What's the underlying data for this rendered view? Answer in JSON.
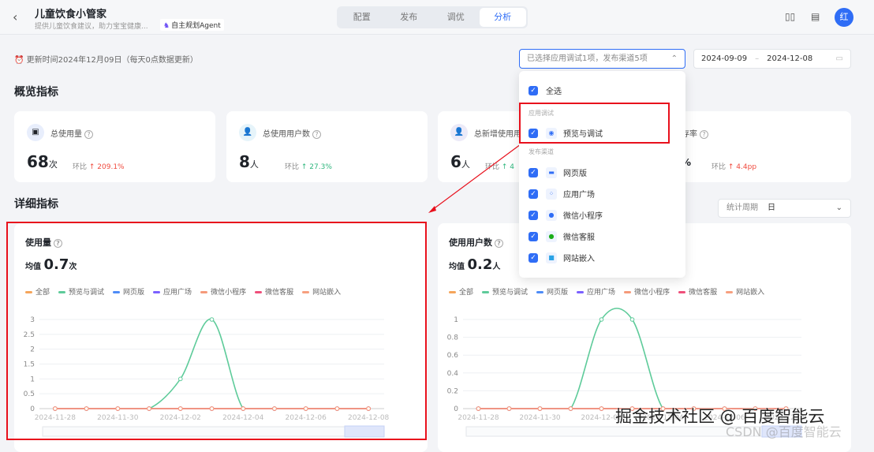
{
  "header": {
    "title": "儿童饮食小管家",
    "subtitle": "提供儿童饮食建议，助力宝宝健康...",
    "badge": "自主规划Agent",
    "avatar": "红",
    "tabs": [
      {
        "label": "配置"
      },
      {
        "label": "发布"
      },
      {
        "label": "调优"
      },
      {
        "label": "分析"
      }
    ]
  },
  "update_text": "更新时间2024年12月09日（每天0点数据更新）",
  "filter": {
    "selected_text": "已选择应用调试1项，发布渠道5项",
    "date_start": "2024-09-09",
    "date_end": "2024-12-08",
    "period_label": "统计周期",
    "period_value": "日"
  },
  "overview": {
    "title": "概览指标",
    "compare_label": "环比",
    "cards": [
      {
        "label": "总使用量",
        "value": "68",
        "unit": "次",
        "change": "↑ 209.1%"
      },
      {
        "label": "总使用用户数",
        "value": "8",
        "unit": "人",
        "change": "↑ 27.3%"
      },
      {
        "label": "总新增使用用户数",
        "value": "6",
        "unit": "人",
        "change": "↑ 4"
      },
      {
        "label": "使用用户平均日留存率",
        "value": "",
        "unit": "%",
        "change": "↑ 4.4pp"
      }
    ]
  },
  "detail": {
    "title": "详细指标"
  },
  "dropdown": {
    "select_all": "全选",
    "group1": "应用调试",
    "group2": "发布渠道",
    "items": [
      {
        "label": "预览与调试"
      },
      {
        "label": "网页版"
      },
      {
        "label": "应用广场"
      },
      {
        "label": "微信小程序"
      },
      {
        "label": "微信客服"
      },
      {
        "label": "网站嵌入"
      }
    ]
  },
  "watermark": {
    "main": "掘金技术社区 @ 百度智能云",
    "sub": "CSDN @百度智能云"
  },
  "chart_data": [
    {
      "type": "line",
      "title": "使用量",
      "avg_label": "均值",
      "avg": "0.7",
      "avg_unit": "次",
      "x": [
        "2024-11-28",
        "2024-11-29",
        "2024-11-30",
        "2024-12-01",
        "2024-12-02",
        "2024-12-03",
        "2024-12-04",
        "2024-12-05",
        "2024-12-06",
        "2024-12-07",
        "2024-12-08"
      ],
      "xticks": [
        "2024-11-28",
        "2024-11-30",
        "2024-12-02",
        "2024-12-04",
        "2024-12-06",
        "2024-12-08"
      ],
      "ylim": [
        0,
        3
      ],
      "yticks": [
        "0",
        "0.5",
        "1",
        "1.5",
        "2",
        "2.5",
        "3"
      ],
      "series": [
        {
          "name": "全部",
          "color": "#f5a55b",
          "values": [
            0,
            0,
            0,
            0,
            0,
            0,
            0,
            0,
            0,
            0,
            0
          ]
        },
        {
          "name": "预览与调试",
          "color": "#5ecb9a",
          "values": [
            0,
            0,
            0,
            0,
            1,
            3,
            0,
            0,
            0,
            0,
            0
          ]
        },
        {
          "name": "网页版",
          "color": "#4e8cf7",
          "values": [
            0,
            0,
            0,
            0,
            0,
            0,
            0,
            0,
            0,
            0,
            0
          ]
        },
        {
          "name": "应用广场",
          "color": "#7b61ff",
          "values": [
            0,
            0,
            0,
            0,
            0,
            0,
            0,
            0,
            0,
            0,
            0
          ]
        },
        {
          "name": "微信小程序",
          "color": "#f59a7a",
          "values": [
            0,
            0,
            0,
            0,
            0,
            0,
            0,
            0,
            0,
            0,
            0
          ]
        },
        {
          "name": "微信客服",
          "color": "#ef4f7a",
          "values": [
            0,
            0,
            0,
            0,
            0,
            0,
            0,
            0,
            0,
            0,
            0
          ]
        },
        {
          "name": "网站嵌入",
          "color": "#f7a07f",
          "values": [
            0,
            0,
            0,
            0,
            0,
            0,
            0,
            0,
            0,
            0,
            0
          ]
        }
      ]
    },
    {
      "type": "line",
      "title": "使用用户数",
      "avg_label": "均值",
      "avg": "0.2",
      "avg_unit": "人",
      "x": [
        "2024-11-28",
        "2024-11-29",
        "2024-11-30",
        "2024-12-01",
        "2024-12-02",
        "2024-12-03",
        "2024-12-04",
        "2024-12-05",
        "2024-12-06",
        "2024-12-07",
        "2024-12-08"
      ],
      "xticks": [
        "2024-11-28",
        "2024-11-30",
        "2024-12-02",
        "2024-12-04",
        "2024-12-06",
        "2024-12-08"
      ],
      "ylim": [
        0,
        1
      ],
      "yticks": [
        "0",
        "0.2",
        "0.4",
        "0.6",
        "0.8",
        "1"
      ],
      "series": [
        {
          "name": "全部",
          "color": "#f5a55b",
          "values": [
            0,
            0,
            0,
            0,
            0,
            0,
            0,
            0,
            0,
            0,
            0
          ]
        },
        {
          "name": "预览与调试",
          "color": "#5ecb9a",
          "values": [
            0,
            0,
            0,
            0,
            1,
            1,
            0,
            0,
            0,
            0,
            0
          ]
        },
        {
          "name": "网页版",
          "color": "#4e8cf7",
          "values": [
            0,
            0,
            0,
            0,
            0,
            0,
            0,
            0,
            0,
            0,
            0
          ]
        },
        {
          "name": "应用广场",
          "color": "#7b61ff",
          "values": [
            0,
            0,
            0,
            0,
            0,
            0,
            0,
            0,
            0,
            0,
            0
          ]
        },
        {
          "name": "微信小程序",
          "color": "#f59a7a",
          "values": [
            0,
            0,
            0,
            0,
            0,
            0,
            0,
            0,
            0,
            0,
            0
          ]
        },
        {
          "name": "微信客服",
          "color": "#ef4f7a",
          "values": [
            0,
            0,
            0,
            0,
            0,
            0,
            0,
            0,
            0,
            0,
            0
          ]
        },
        {
          "name": "网站嵌入",
          "color": "#f7a07f",
          "values": [
            0,
            0,
            0,
            0,
            0,
            0,
            0,
            0,
            0,
            0,
            0
          ]
        }
      ]
    }
  ]
}
